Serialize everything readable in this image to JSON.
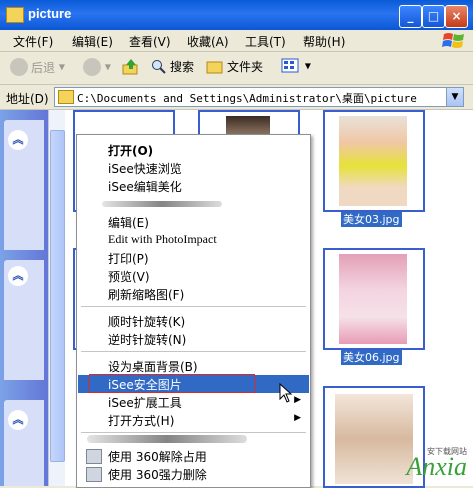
{
  "window": {
    "title": "picture"
  },
  "menu": [
    "文件(F)",
    "编辑(E)",
    "查看(V)",
    "收藏(A)",
    "工具(T)",
    "帮助(H)"
  ],
  "toolbar": {
    "back": "后退",
    "search": "搜索",
    "folders": "文件夹"
  },
  "address": {
    "label": "地址(D)",
    "path": "C:\\Documents and Settings\\Administrator\\桌面\\picture"
  },
  "files": [
    {
      "caption": "美女03.jpg"
    },
    {
      "caption": "美女06.jpg"
    }
  ],
  "context_menu": {
    "open": "打开(O)",
    "quick_view": "iSee快速浏览",
    "edit_beautify": "iSee编辑美化",
    "edit": "编辑(E)",
    "photoimpact": "Edit with PhotoImpact",
    "print": "打印(P)",
    "preview": "预览(V)",
    "refresh_thumb": "刷新缩略图(F)",
    "rotate_cw": "顺时针旋转(K)",
    "rotate_ccw": "逆时针旋转(N)",
    "set_wallpaper": "设为桌面背景(B)",
    "secure_image": "iSee安全图片",
    "ext_tools": "iSee扩展工具",
    "open_with": "打开方式(H)",
    "unlock_360": "使用 360解除占用",
    "force_delete_360": "使用 360强力删除"
  },
  "watermark": {
    "brand": "Anxia",
    "sub": "安下载网站"
  }
}
